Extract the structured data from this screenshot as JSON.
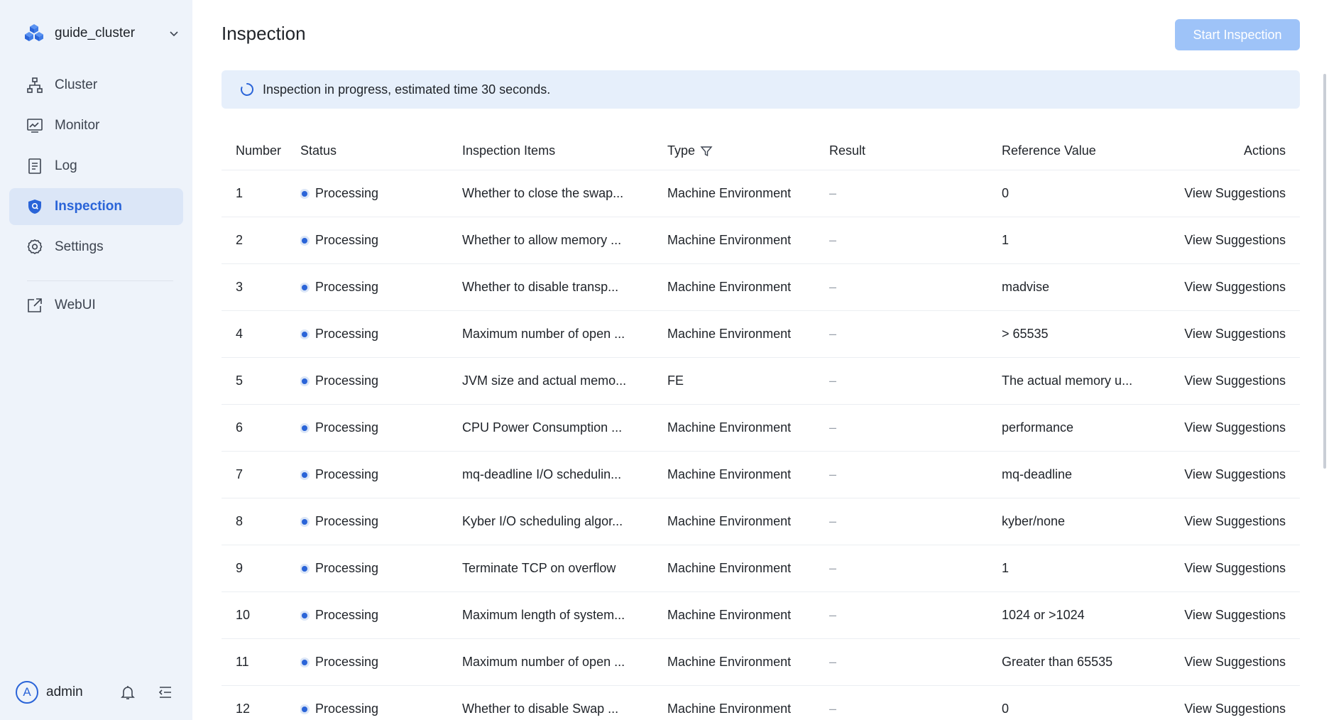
{
  "sidebar": {
    "cluster_name": "guide_cluster",
    "items": [
      {
        "label": "Cluster",
        "icon": "cluster-icon"
      },
      {
        "label": "Monitor",
        "icon": "monitor-icon"
      },
      {
        "label": "Log",
        "icon": "log-icon"
      },
      {
        "label": "Inspection",
        "icon": "shield-icon",
        "active": true
      },
      {
        "label": "Settings",
        "icon": "gear-icon"
      },
      {
        "label": "WebUI",
        "icon": "external-link-icon"
      }
    ],
    "user": {
      "avatar_letter": "A",
      "name": "admin"
    }
  },
  "header": {
    "title": "Inspection",
    "start_button": "Start Inspection"
  },
  "banner": {
    "text": "Inspection in progress, estimated time 30 seconds."
  },
  "table": {
    "columns": [
      "Number",
      "Status",
      "Inspection Items",
      "Type",
      "Result",
      "Reference Value",
      "Actions"
    ],
    "rows": [
      {
        "number": "1",
        "status": "Processing",
        "item": "Whether to close the swap...",
        "type": "Machine Environment",
        "result": "–",
        "reference": "0",
        "action": "View Suggestions"
      },
      {
        "number": "2",
        "status": "Processing",
        "item": "Whether to allow memory ...",
        "type": "Machine Environment",
        "result": "–",
        "reference": "1",
        "action": "View Suggestions"
      },
      {
        "number": "3",
        "status": "Processing",
        "item": "Whether to disable transp...",
        "type": "Machine Environment",
        "result": "–",
        "reference": "madvise",
        "action": "View Suggestions"
      },
      {
        "number": "4",
        "status": "Processing",
        "item": "Maximum number of open ...",
        "type": "Machine Environment",
        "result": "–",
        "reference": "> 65535",
        "action": "View Suggestions"
      },
      {
        "number": "5",
        "status": "Processing",
        "item": "JVM size and actual memo...",
        "type": "FE",
        "result": "–",
        "reference": "The actual memory u...",
        "action": "View Suggestions"
      },
      {
        "number": "6",
        "status": "Processing",
        "item": "CPU Power Consumption ...",
        "type": "Machine Environment",
        "result": "–",
        "reference": "performance",
        "action": "View Suggestions"
      },
      {
        "number": "7",
        "status": "Processing",
        "item": "mq-deadline I/O schedulin...",
        "type": "Machine Environment",
        "result": "–",
        "reference": "mq-deadline",
        "action": "View Suggestions"
      },
      {
        "number": "8",
        "status": "Processing",
        "item": "Kyber I/O scheduling algor...",
        "type": "Machine Environment",
        "result": "–",
        "reference": "kyber/none",
        "action": "View Suggestions"
      },
      {
        "number": "9",
        "status": "Processing",
        "item": "Terminate TCP on overflow",
        "type": "Machine Environment",
        "result": "–",
        "reference": "1",
        "action": "View Suggestions"
      },
      {
        "number": "10",
        "status": "Processing",
        "item": "Maximum length of system...",
        "type": "Machine Environment",
        "result": "–",
        "reference": "1024 or >1024",
        "action": "View Suggestions"
      },
      {
        "number": "11",
        "status": "Processing",
        "item": "Maximum number of open ...",
        "type": "Machine Environment",
        "result": "–",
        "reference": "Greater than 65535",
        "action": "View Suggestions"
      },
      {
        "number": "12",
        "status": "Processing",
        "item": "Whether to disable Swap ...",
        "type": "Machine Environment",
        "result": "–",
        "reference": "0",
        "action": "View Suggestions"
      }
    ]
  },
  "colors": {
    "accent": "#2a64d8",
    "sidebar_bg": "#eef3fa",
    "active_bg": "#dbe6f7",
    "banner_bg": "#e6effb",
    "button_disabled": "#9ec3f8"
  }
}
